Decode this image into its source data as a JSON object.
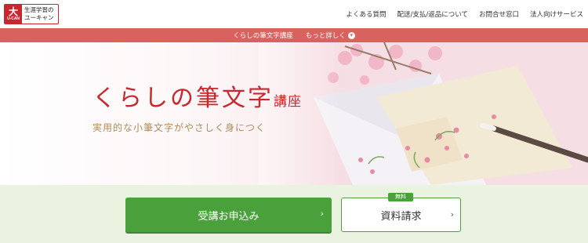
{
  "header": {
    "logo": {
      "mark_text": "大",
      "mark_sub": "U-CAN",
      "line1": "生涯学習の",
      "line2": "ユーキャン"
    },
    "nav": [
      "よくある質問",
      "配送/支払/返品について",
      "お問合せ窓口",
      "法人向けサービス"
    ]
  },
  "coursebar": {
    "course_label": "くらしの筆文字講座",
    "more_label": "もっと詳しく"
  },
  "hero": {
    "title_main": "くらしの筆文字",
    "title_suffix": "講座",
    "subtitle": "実用的な小筆文字がやさしく身につく"
  },
  "cta": {
    "apply_label": "受講お申込み",
    "document_label": "資料請求",
    "free_badge": "無料"
  },
  "colors": {
    "brand_red": "#c8272d",
    "bar_red": "#d9625f",
    "cta_green": "#4aa13b",
    "band_bg": "#e9f3df"
  }
}
